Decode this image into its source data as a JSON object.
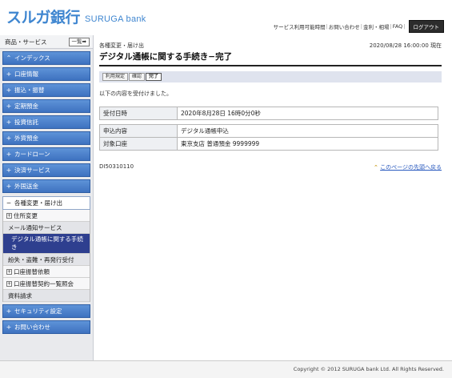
{
  "header": {
    "logo_jp": "スルガ銀行",
    "logo_en": "SURUGA bank",
    "links": [
      "サービス利用可能時間",
      "お問い合わせ",
      "金利・相場",
      "FAQ"
    ],
    "logout": "ログアウト"
  },
  "sidebar": {
    "heading": "商品・サービス",
    "list_button": "一覧",
    "items_top": [
      {
        "sym": "⌃",
        "label": "インデックス"
      },
      {
        "sym": "+",
        "label": "口座情報"
      },
      {
        "sym": "+",
        "label": "振込・振替"
      },
      {
        "sym": "+",
        "label": "定期預金"
      },
      {
        "sym": "+",
        "label": "投資信託"
      },
      {
        "sym": "+",
        "label": "外貨預金"
      },
      {
        "sym": "+",
        "label": "カードローン"
      },
      {
        "sym": "+",
        "label": "決済サービス"
      },
      {
        "sym": "+",
        "label": "外国送金"
      }
    ],
    "open_item": {
      "sym": "−",
      "label": "各種変更・届け出"
    },
    "sub_items": {
      "s0": "住所変更",
      "s1": "メール通知サービス",
      "s2": "デジタル通帳に関する手続き",
      "s3": "紛失・盗難・再発行受付",
      "s4": "口座振替依頼",
      "s5": "口座振替契約一覧照会",
      "s6": "資料請求"
    },
    "items_bottom": [
      {
        "sym": "+",
        "label": "セキュリティ設定"
      },
      {
        "sym": "+",
        "label": "お問い合わせ"
      }
    ]
  },
  "main": {
    "breadcrumb": "各種変更・届け出",
    "datetime": "2020/08/28 16:00:00 現在",
    "title": "デジタル通帳に関する手続き−完了",
    "steps": [
      "利用規定",
      "確認",
      "完了"
    ],
    "message": "以下の内容を受付けました。",
    "table1": [
      {
        "k": "受付日時",
        "v": "2020年8月28日 16時0分0秒"
      }
    ],
    "table2": [
      {
        "k": "申込内容",
        "v": "デジタル通帳申込"
      },
      {
        "k": "対象口座",
        "v": "東京支店 普通預金 9999999"
      }
    ],
    "screen_id": "DI50310110",
    "page_top": "このページの先頭へ戻る"
  },
  "footer": {
    "copyright": "Copyright © 2012 SURUGA bank Ltd. All Rights Reserved."
  }
}
